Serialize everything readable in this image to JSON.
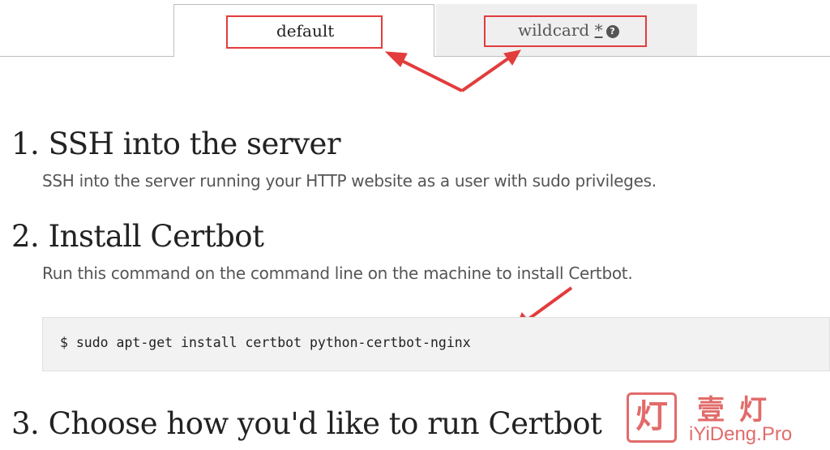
{
  "tabs": {
    "default_label": "default",
    "wildcard_label": "wildcard",
    "wildcard_star": "*",
    "help_glyph": "?"
  },
  "steps": [
    {
      "title": "1. SSH into the server",
      "description": "SSH into the server running your HTTP website as a user with sudo privileges."
    },
    {
      "title": "2. Install Certbot",
      "description": "Run this command on the command line on the machine to install Certbot."
    },
    {
      "title": "3. Choose how you'd like to run Certbot"
    }
  ],
  "code": {
    "command": "$ sudo apt-get install certbot python-certbot-nginx"
  },
  "watermark": {
    "logo_char": "灯",
    "chinese": "壹灯",
    "site": "iYiDeng.Pro"
  },
  "colors": {
    "annotation": "#e23c3c",
    "watermark": "#e26b6b",
    "code_bg": "#f2f2f2"
  }
}
